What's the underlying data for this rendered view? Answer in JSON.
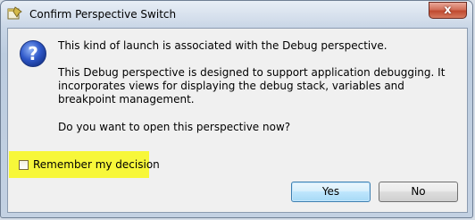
{
  "window": {
    "title": "Confirm Perspective Switch",
    "title_icon": "eclipse-perspective-icon",
    "close_label": "x"
  },
  "dialog": {
    "icon": "question-icon",
    "icon_glyph": "?",
    "message_line1": "This kind of launch is associated with the Debug perspective.",
    "message_line2": "This Debug perspective is designed to support application debugging.  It incorporates views for displaying the debug stack, variables and breakpoint management.",
    "question": "Do you want to open this perspective now?",
    "remember_label": "Remember my decision",
    "remember_checked": false
  },
  "buttons": {
    "yes_label": "Yes",
    "no_label": "No"
  },
  "colors": {
    "highlight": "#f7f73a",
    "question_icon": "#2f58c9",
    "default_button_border": "#3c7fb1",
    "close_button": "#c04a30"
  }
}
